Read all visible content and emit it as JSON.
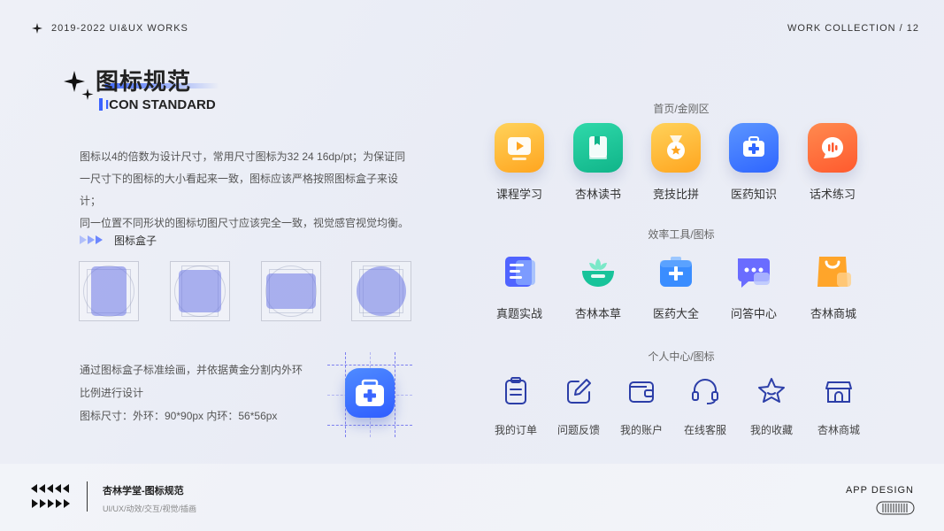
{
  "header": {
    "left": "2019-2022 UI&UX WORKS",
    "right": "WORK COLLECTION / 12"
  },
  "title": {
    "cn": "图标规范",
    "en_first": "I",
    "en_rest": "CON STANDARD"
  },
  "description": [
    "图标以4的倍数为设计尺寸，常用尺寸图标为32 24 16dp/pt；为保证同",
    "一尺寸下的图标的大小看起来一致，图标应该严格按照图标盒子来设计；",
    "同一位置不同形状的图标切图尺寸应该完全一致，视觉感官视觉均衡。"
  ],
  "icon_box": {
    "label": "图标盒子"
  },
  "method": {
    "line1": "通过图标盒子标准绘画，并依据黄金分割内外环",
    "line2": "比例进行设计",
    "line3": "图标尺寸：外环：90*90px   内环：56*56px"
  },
  "sections": {
    "home": {
      "title": "首页/金刚区",
      "items": [
        {
          "label": "课程学习",
          "icon": "video-course-icon",
          "color": "#ffb42a"
        },
        {
          "label": "杏林读书",
          "icon": "book-icon",
          "color": "#1cc39a"
        },
        {
          "label": "竞技比拼",
          "icon": "medal-icon",
          "color": "#ffb42a"
        },
        {
          "label": "医药知识",
          "icon": "medical-kit-icon",
          "color": "#3f7bff"
        },
        {
          "label": "话术练习",
          "icon": "voice-chat-icon",
          "color": "#ff6a3d"
        }
      ]
    },
    "tools": {
      "title": "效率工具/图标",
      "items": [
        {
          "label": "真题实战",
          "icon": "exam-paper-icon",
          "color": "#4a5cff"
        },
        {
          "label": "杏林本草",
          "icon": "herb-bowl-icon",
          "color": "#1cc39a"
        },
        {
          "label": "医药大全",
          "icon": "medical-box-icon",
          "color": "#2f8bff"
        },
        {
          "label": "问答中心",
          "icon": "qa-chat-icon",
          "color": "#6a6cff"
        },
        {
          "label": "杏林商城",
          "icon": "shopping-bag-icon",
          "color": "#ffa52a"
        }
      ]
    },
    "personal": {
      "title": "个人中心/图标",
      "items": [
        {
          "label": "我的订单",
          "icon": "order-list-icon"
        },
        {
          "label": "问题反馈",
          "icon": "feedback-edit-icon"
        },
        {
          "label": "我的账户",
          "icon": "wallet-icon"
        },
        {
          "label": "在线客服",
          "icon": "headset-icon"
        },
        {
          "label": "我的收藏",
          "icon": "star-icon"
        },
        {
          "label": "杏林商城",
          "icon": "store-icon"
        }
      ]
    }
  },
  "footer": {
    "title": "杏林学堂-图标规范",
    "subtitle": "UI/UX/动效/交互/视觉/插画",
    "right": "APP DESIGN"
  },
  "colors": {
    "accent": "#3a62ff",
    "line_icon": "#2c3ea8"
  }
}
